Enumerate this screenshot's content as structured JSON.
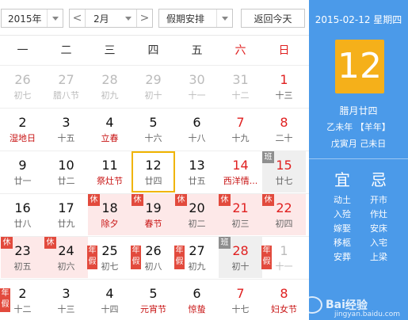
{
  "toolbar": {
    "year": "2015年",
    "month": "2月",
    "holiday_select": "假期安排",
    "today_button": "返回今天",
    "prev_arrow": "<",
    "next_arrow": ">"
  },
  "weekdays": [
    "一",
    "二",
    "三",
    "四",
    "五",
    "六",
    "日"
  ],
  "weeks": [
    [
      {
        "d": "26",
        "l": "初七",
        "gray": true
      },
      {
        "d": "27",
        "l": "腊八节",
        "gray": true
      },
      {
        "d": "28",
        "l": "初九",
        "gray": true
      },
      {
        "d": "29",
        "l": "初十",
        "gray": true
      },
      {
        "d": "30",
        "l": "十一",
        "gray": true
      },
      {
        "d": "31",
        "l": "十二",
        "gray": true
      },
      {
        "d": "1",
        "l": "十三",
        "dred": true
      }
    ],
    [
      {
        "d": "2",
        "l": "湿地日",
        "lred": true
      },
      {
        "d": "3",
        "l": "十五"
      },
      {
        "d": "4",
        "l": "立春",
        "lred": true
      },
      {
        "d": "5",
        "l": "十六"
      },
      {
        "d": "6",
        "l": "十八"
      },
      {
        "d": "7",
        "l": "十九",
        "dred": true
      },
      {
        "d": "8",
        "l": "二十",
        "dred": true
      }
    ],
    [
      {
        "d": "9",
        "l": "廿一"
      },
      {
        "d": "10",
        "l": "廿二"
      },
      {
        "d": "11",
        "l": "祭灶节",
        "lred": true
      },
      {
        "d": "12",
        "l": "廿四",
        "today": true
      },
      {
        "d": "13",
        "l": "廿五"
      },
      {
        "d": "14",
        "l": "西洋情...",
        "dred": true,
        "lred": true
      },
      {
        "d": "15",
        "l": "廿七",
        "dred": true,
        "work": true,
        "tag": "班"
      }
    ],
    [
      {
        "d": "16",
        "l": "廿八"
      },
      {
        "d": "17",
        "l": "廿九"
      },
      {
        "d": "18",
        "l": "除夕",
        "hol": true,
        "tag": "休",
        "lred": true
      },
      {
        "d": "19",
        "l": "春节",
        "hol": true,
        "tag": "休",
        "lred": true
      },
      {
        "d": "20",
        "l": "初二",
        "hol": true,
        "tag": "休"
      },
      {
        "d": "21",
        "l": "初三",
        "hol": true,
        "tag": "休",
        "dred": true
      },
      {
        "d": "22",
        "l": "初四",
        "hol": true,
        "tag": "休",
        "dred": true
      }
    ],
    [
      {
        "d": "23",
        "l": "初五",
        "hol": true,
        "tag": "休"
      },
      {
        "d": "24",
        "l": "初六",
        "hol": true,
        "tag": "休"
      },
      {
        "d": "25",
        "l": "初七",
        "tag": "年假"
      },
      {
        "d": "26",
        "l": "初八",
        "tag": "年假"
      },
      {
        "d": "27",
        "l": "初九",
        "tag": "年假"
      },
      {
        "d": "28",
        "l": "初十",
        "dred": true,
        "work": true,
        "tag": "班"
      },
      {
        "d": "1",
        "l": "十一",
        "gray": true,
        "tag": "年假"
      }
    ],
    [
      {
        "d": "2",
        "l": "十二",
        "tag": "年假"
      },
      {
        "d": "3",
        "l": "十三"
      },
      {
        "d": "4",
        "l": "十四"
      },
      {
        "d": "5",
        "l": "元宵节",
        "lred": true
      },
      {
        "d": "6",
        "l": "惊蛰",
        "lred": true
      },
      {
        "d": "7",
        "l": "十七",
        "dred": true
      },
      {
        "d": "8",
        "l": "妇女节",
        "dred": true,
        "lred": true
      }
    ]
  ],
  "side": {
    "date_line": "2015-02-12 星期四",
    "big_day": "12",
    "lunar_line": "腊月廿四",
    "year_line": "乙未年 【羊年】",
    "month_day_line": "戊寅月 己未日",
    "yi_title": "宜",
    "ji_title": "忌",
    "yi_items": [
      "动土",
      "入殓",
      "嫁娶",
      "移柩",
      "安葬"
    ],
    "ji_items": [
      "开市",
      "作灶",
      "安床",
      "入宅",
      "上梁"
    ]
  },
  "watermark": {
    "logo_text": "Bai",
    "brand": "经验",
    "url": "jingyan.baidu.com"
  }
}
